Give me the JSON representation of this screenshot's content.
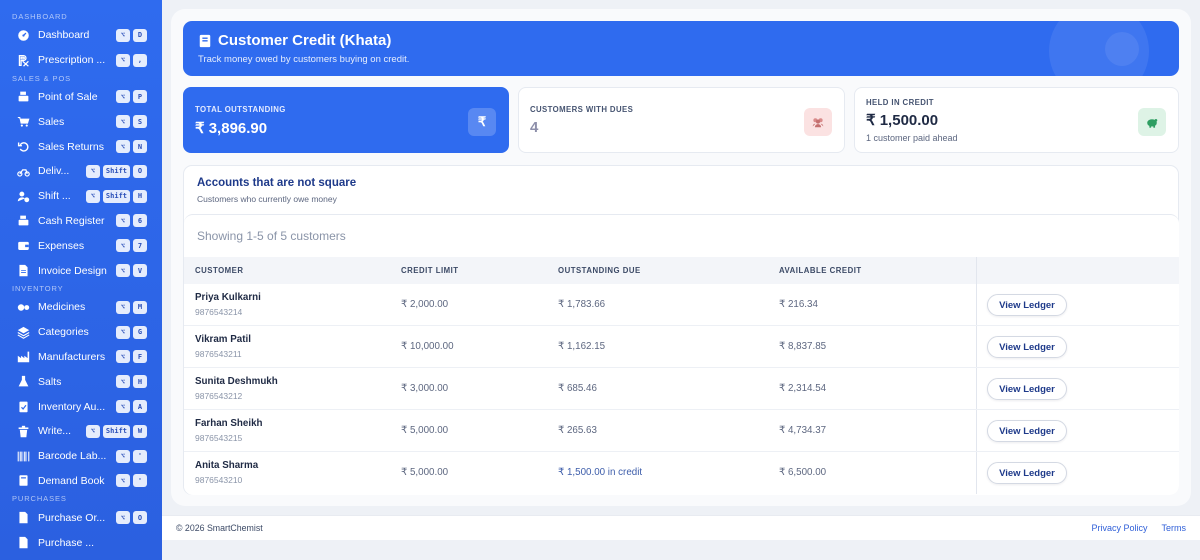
{
  "sidebar": {
    "sections": [
      {
        "title": "DASHBOARD",
        "items": [
          {
            "label": "Dashboard",
            "icon": "gauge-icon",
            "keys": [
              "⌥",
              "D"
            ]
          },
          {
            "label": "Prescription ...",
            "icon": "prescription-icon",
            "keys": [
              "⌥",
              ","
            ]
          }
        ]
      },
      {
        "title": "SALES & POS",
        "items": [
          {
            "label": "Point of Sale",
            "icon": "cash-register-icon",
            "keys": [
              "⌥",
              "P"
            ]
          },
          {
            "label": "Sales",
            "icon": "cart-icon",
            "keys": [
              "⌥",
              "S"
            ]
          },
          {
            "label": "Sales Returns",
            "icon": "undo-icon",
            "keys": [
              "⌥",
              "N"
            ]
          },
          {
            "label": "Deliv...",
            "icon": "motorcycle-icon",
            "keys": [
              "⌥",
              "Shift",
              "O"
            ]
          },
          {
            "label": "Shift ...",
            "icon": "user-clock-icon",
            "keys": [
              "⌥",
              "Shift",
              "H"
            ]
          },
          {
            "label": "Cash Register",
            "icon": "cash-register-icon",
            "keys": [
              "⌥",
              "6"
            ]
          },
          {
            "label": "Expenses",
            "icon": "wallet-icon",
            "keys": [
              "⌥",
              "7"
            ]
          },
          {
            "label": "Invoice Design",
            "icon": "file-invoice-icon",
            "keys": [
              "⌥",
              "V"
            ]
          }
        ]
      },
      {
        "title": "INVENTORY",
        "items": [
          {
            "label": "Medicines",
            "icon": "pills-icon",
            "keys": [
              "⌥",
              "M"
            ]
          },
          {
            "label": "Categories",
            "icon": "layers-icon",
            "keys": [
              "⌥",
              "G"
            ]
          },
          {
            "label": "Manufacturers",
            "icon": "industry-icon",
            "keys": [
              "⌥",
              "F"
            ]
          },
          {
            "label": "Salts",
            "icon": "flask-icon",
            "keys": [
              "⌥",
              "H"
            ]
          },
          {
            "label": "Inventory Au...",
            "icon": "clipboard-check-icon",
            "keys": [
              "⌥",
              "A"
            ]
          },
          {
            "label": "Write...",
            "icon": "trash-icon",
            "keys": [
              "⌥",
              "Shift",
              "W"
            ]
          },
          {
            "label": "Barcode Lab...",
            "icon": "barcode-icon",
            "keys": [
              "⌥",
              "'"
            ]
          },
          {
            "label": "Demand Book",
            "icon": "book-icon",
            "keys": [
              "⌥",
              "'"
            ]
          }
        ]
      },
      {
        "title": "PURCHASES",
        "items": [
          {
            "label": "Purchase Or...",
            "icon": "file-icon",
            "keys": [
              "⌥",
              "O"
            ]
          },
          {
            "label": "Purchase ...",
            "icon": "file-icon",
            "keys": []
          }
        ]
      }
    ]
  },
  "header": {
    "title": "Customer Credit (Khata)",
    "subtitle": "Track money owed by customers buying on credit.",
    "icon": "book-icon"
  },
  "stats": [
    {
      "label": "TOTAL OUTSTANDING",
      "value": "₹ 3,896.90",
      "icon_glyph": "₹",
      "icon": "rupee-icon"
    },
    {
      "label": "CUSTOMERS WITH DUES",
      "value": "4",
      "icon": "users-icon"
    },
    {
      "label": "HELD IN CREDIT",
      "value": "₹ 1,500.00",
      "note": "1 customer paid ahead",
      "icon": "piggy-bank-icon"
    }
  ],
  "accounts": {
    "title": "Accounts that are not square",
    "subtitle": "Customers who currently owe money",
    "showing": "Showing 1-5 of 5 customers",
    "columns": [
      "CUSTOMER",
      "CREDIT LIMIT",
      "OUTSTANDING DUE",
      "AVAILABLE CREDIT"
    ],
    "action_label": "View Ledger",
    "rows": [
      {
        "name": "Priya Kulkarni",
        "phone": "9876543214",
        "credit_limit": "₹ 2,000.00",
        "due": "₹ 1,783.66",
        "available": "₹ 216.34"
      },
      {
        "name": "Vikram Patil",
        "phone": "9876543211",
        "credit_limit": "₹ 10,000.00",
        "due": "₹ 1,162.15",
        "available": "₹ 8,837.85"
      },
      {
        "name": "Sunita Deshmukh",
        "phone": "9876543212",
        "credit_limit": "₹ 3,000.00",
        "due": "₹ 685.46",
        "available": "₹ 2,314.54"
      },
      {
        "name": "Farhan Sheikh",
        "phone": "9876543215",
        "credit_limit": "₹ 5,000.00",
        "due": "₹ 265.63",
        "available": "₹ 4,734.37"
      },
      {
        "name": "Anita Sharma",
        "phone": "9876543210",
        "credit_limit": "₹ 5,000.00",
        "due": "₹ 1,500.00 in credit",
        "available": "₹ 6,500.00"
      }
    ]
  },
  "footer": {
    "copyright": "© 2026 SmartChemist",
    "links": [
      "Privacy Policy",
      "Terms"
    ]
  },
  "colors": {
    "primary": "#2f6bef",
    "heading": "#1e3a8a",
    "muted": "#8a94a8"
  }
}
